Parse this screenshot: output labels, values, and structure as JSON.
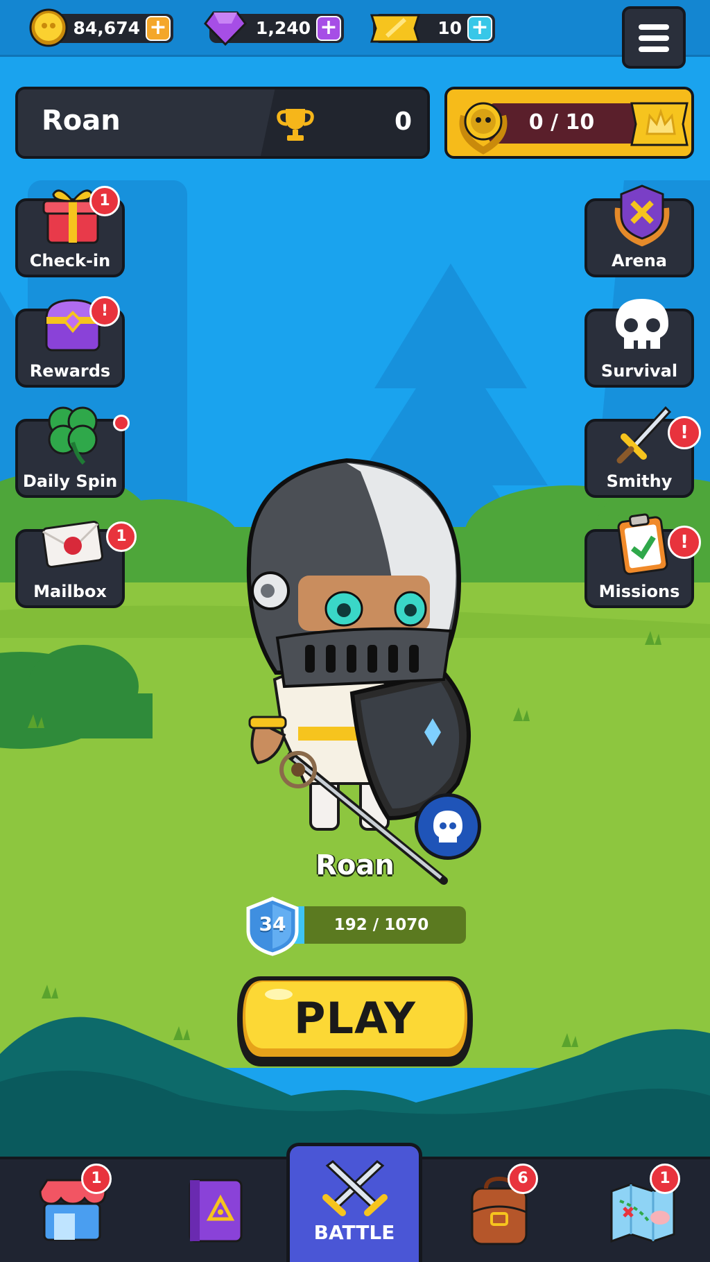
{
  "currencies": {
    "gold": {
      "icon": "coin-icon",
      "value": "84,674"
    },
    "gems": {
      "icon": "gem-icon",
      "value": "1,240"
    },
    "tickets": {
      "icon": "ticket-icon",
      "value": "10"
    },
    "add_symbol": "+"
  },
  "player": {
    "name": "Roan",
    "trophies": "0",
    "rank_progress": "0 / 10"
  },
  "left_buttons": [
    {
      "label": "Check-in",
      "icon": "gift-icon",
      "badge": "1"
    },
    {
      "label": "Rewards",
      "icon": "chest-icon",
      "badge": "!"
    },
    {
      "label": "Daily Spin",
      "icon": "clover-icon",
      "badge": ""
    },
    {
      "label": "Mailbox",
      "icon": "envelope-icon",
      "badge": "1"
    }
  ],
  "right_buttons": [
    {
      "label": "Arena",
      "icon": "arena-emblem-icon"
    },
    {
      "label": "Survival",
      "icon": "skull-icon"
    },
    {
      "label": "Smithy",
      "icon": "sword-icon",
      "badge": "!"
    },
    {
      "label": "Missions",
      "icon": "clipboard-icon",
      "badge": "!"
    }
  ],
  "hero": {
    "name": "Roan",
    "level": "34",
    "xp_text": "192 / 1070",
    "xp_current": 192,
    "xp_max": 1070
  },
  "play_label": "PLAY",
  "bottom_nav": [
    {
      "icon": "shop-icon",
      "badge": "1"
    },
    {
      "icon": "spellbook-icon",
      "badge": ""
    },
    {
      "label": "BATTLE",
      "icon": "crossed-swords-icon",
      "active": true
    },
    {
      "icon": "backpack-icon",
      "badge": "6"
    },
    {
      "icon": "map-icon",
      "badge": "1"
    }
  ],
  "colors": {
    "sky": "#1aa3ee",
    "grass": "#8dc63f",
    "panel": "#2a2f3b",
    "play_yellow": "#fcd835",
    "badge_red": "#e8333d",
    "battle_tab": "#4a56d6"
  }
}
